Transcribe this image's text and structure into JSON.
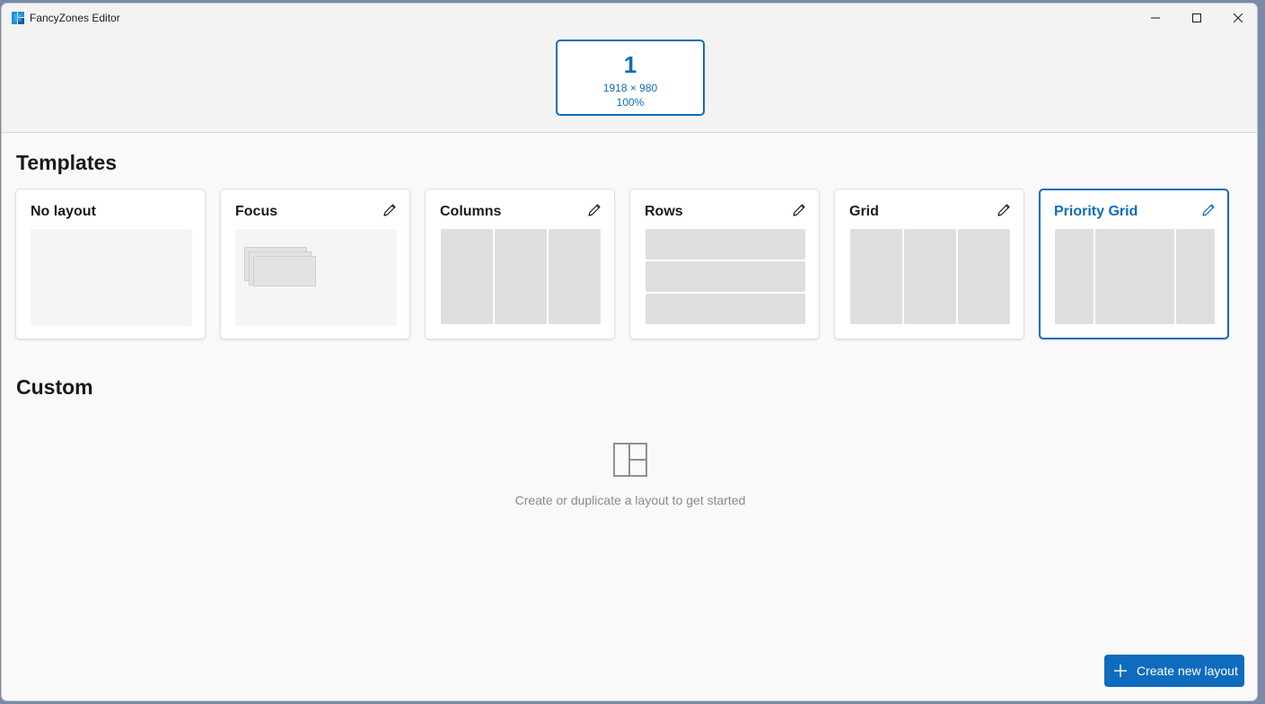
{
  "window": {
    "title": "FancyZones Editor",
    "icon": "fancyzones-app-icon"
  },
  "window_controls": {
    "minimize": "minimize-icon",
    "maximize": "maximize-icon",
    "close": "close-icon"
  },
  "monitor": {
    "number": "1",
    "resolution": "1918 × 980",
    "scale": "100%"
  },
  "sections": {
    "templates": "Templates",
    "custom": "Custom"
  },
  "templates": [
    {
      "id": "no-layout",
      "title": "No layout",
      "editable": false
    },
    {
      "id": "focus",
      "title": "Focus",
      "editable": true
    },
    {
      "id": "columns",
      "title": "Columns",
      "editable": true
    },
    {
      "id": "rows",
      "title": "Rows",
      "editable": true
    },
    {
      "id": "grid",
      "title": "Grid",
      "editable": true
    },
    {
      "id": "priority-grid",
      "title": "Priority Grid",
      "editable": true,
      "selected": true
    }
  ],
  "custom": {
    "empty_message": "Create or duplicate a layout to get started",
    "empty_icon": "layout-grid-icon"
  },
  "create_button": {
    "label": "Create new layout",
    "icon": "plus-icon"
  },
  "colors": {
    "accent": "#0f6cbd",
    "background": "#f9f9f9",
    "zone": "#dedede"
  }
}
